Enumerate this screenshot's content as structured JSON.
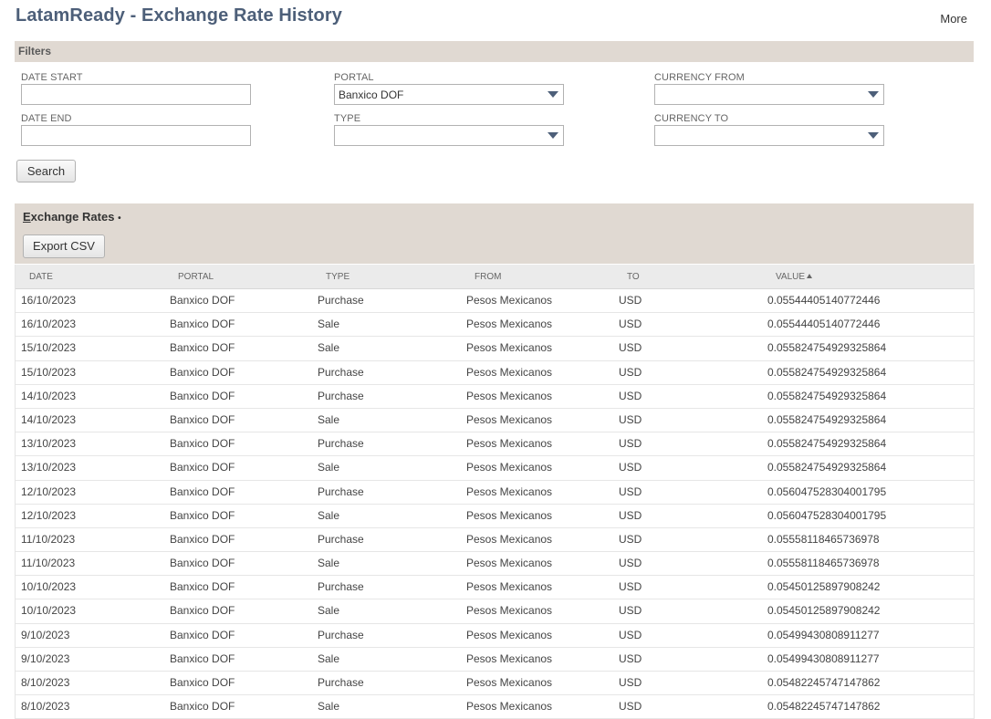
{
  "header": {
    "title": "LatamReady - Exchange Rate History",
    "more_label": "More"
  },
  "filters": {
    "section_label": "Filters",
    "date_start_label": "DATE START",
    "date_end_label": "DATE END",
    "portal_label": "PORTAL",
    "portal_value": "Banxico DOF",
    "type_label": "TYPE",
    "type_value": "",
    "currency_from_label": "CURRENCY FROM",
    "currency_from_value": "",
    "currency_to_label": "CURRENCY TO",
    "currency_to_value": "",
    "search_label": "Search"
  },
  "rates": {
    "title_first": "E",
    "title_rest": "xchange Rates",
    "title_marker": "•",
    "export_label": "Export CSV",
    "columns": [
      "DATE",
      "PORTAL",
      "TYPE",
      "FROM",
      "TO",
      "VALUE"
    ],
    "sort_indicator": "ascending",
    "rows": [
      [
        "16/10/2023",
        "Banxico DOF",
        "Purchase",
        "Pesos Mexicanos",
        "USD",
        "0.05544405140772446"
      ],
      [
        "16/10/2023",
        "Banxico DOF",
        "Sale",
        "Pesos Mexicanos",
        "USD",
        "0.05544405140772446"
      ],
      [
        "15/10/2023",
        "Banxico DOF",
        "Sale",
        "Pesos Mexicanos",
        "USD",
        "0.055824754929325864"
      ],
      [
        "15/10/2023",
        "Banxico DOF",
        "Purchase",
        "Pesos Mexicanos",
        "USD",
        "0.055824754929325864"
      ],
      [
        "14/10/2023",
        "Banxico DOF",
        "Purchase",
        "Pesos Mexicanos",
        "USD",
        "0.055824754929325864"
      ],
      [
        "14/10/2023",
        "Banxico DOF",
        "Sale",
        "Pesos Mexicanos",
        "USD",
        "0.055824754929325864"
      ],
      [
        "13/10/2023",
        "Banxico DOF",
        "Purchase",
        "Pesos Mexicanos",
        "USD",
        "0.055824754929325864"
      ],
      [
        "13/10/2023",
        "Banxico DOF",
        "Sale",
        "Pesos Mexicanos",
        "USD",
        "0.055824754929325864"
      ],
      [
        "12/10/2023",
        "Banxico DOF",
        "Purchase",
        "Pesos Mexicanos",
        "USD",
        "0.056047528304001795"
      ],
      [
        "12/10/2023",
        "Banxico DOF",
        "Sale",
        "Pesos Mexicanos",
        "USD",
        "0.056047528304001795"
      ],
      [
        "11/10/2023",
        "Banxico DOF",
        "Purchase",
        "Pesos Mexicanos",
        "USD",
        "0.05558118465736978"
      ],
      [
        "11/10/2023",
        "Banxico DOF",
        "Sale",
        "Pesos Mexicanos",
        "USD",
        "0.05558118465736978"
      ],
      [
        "10/10/2023",
        "Banxico DOF",
        "Purchase",
        "Pesos Mexicanos",
        "USD",
        "0.05450125897908242"
      ],
      [
        "10/10/2023",
        "Banxico DOF",
        "Sale",
        "Pesos Mexicanos",
        "USD",
        "0.05450125897908242"
      ],
      [
        "9/10/2023",
        "Banxico DOF",
        "Purchase",
        "Pesos Mexicanos",
        "USD",
        "0.05499430808911277"
      ],
      [
        "9/10/2023",
        "Banxico DOF",
        "Sale",
        "Pesos Mexicanos",
        "USD",
        "0.05499430808911277"
      ],
      [
        "8/10/2023",
        "Banxico DOF",
        "Purchase",
        "Pesos Mexicanos",
        "USD",
        "0.05482245747147862"
      ],
      [
        "8/10/2023",
        "Banxico DOF",
        "Sale",
        "Pesos Mexicanos",
        "USD",
        "0.05482245747147862"
      ]
    ]
  },
  "colors": {
    "title": "#4d5f79",
    "section_bar": "#e0d9d2",
    "table_header": "#ebebeb"
  }
}
